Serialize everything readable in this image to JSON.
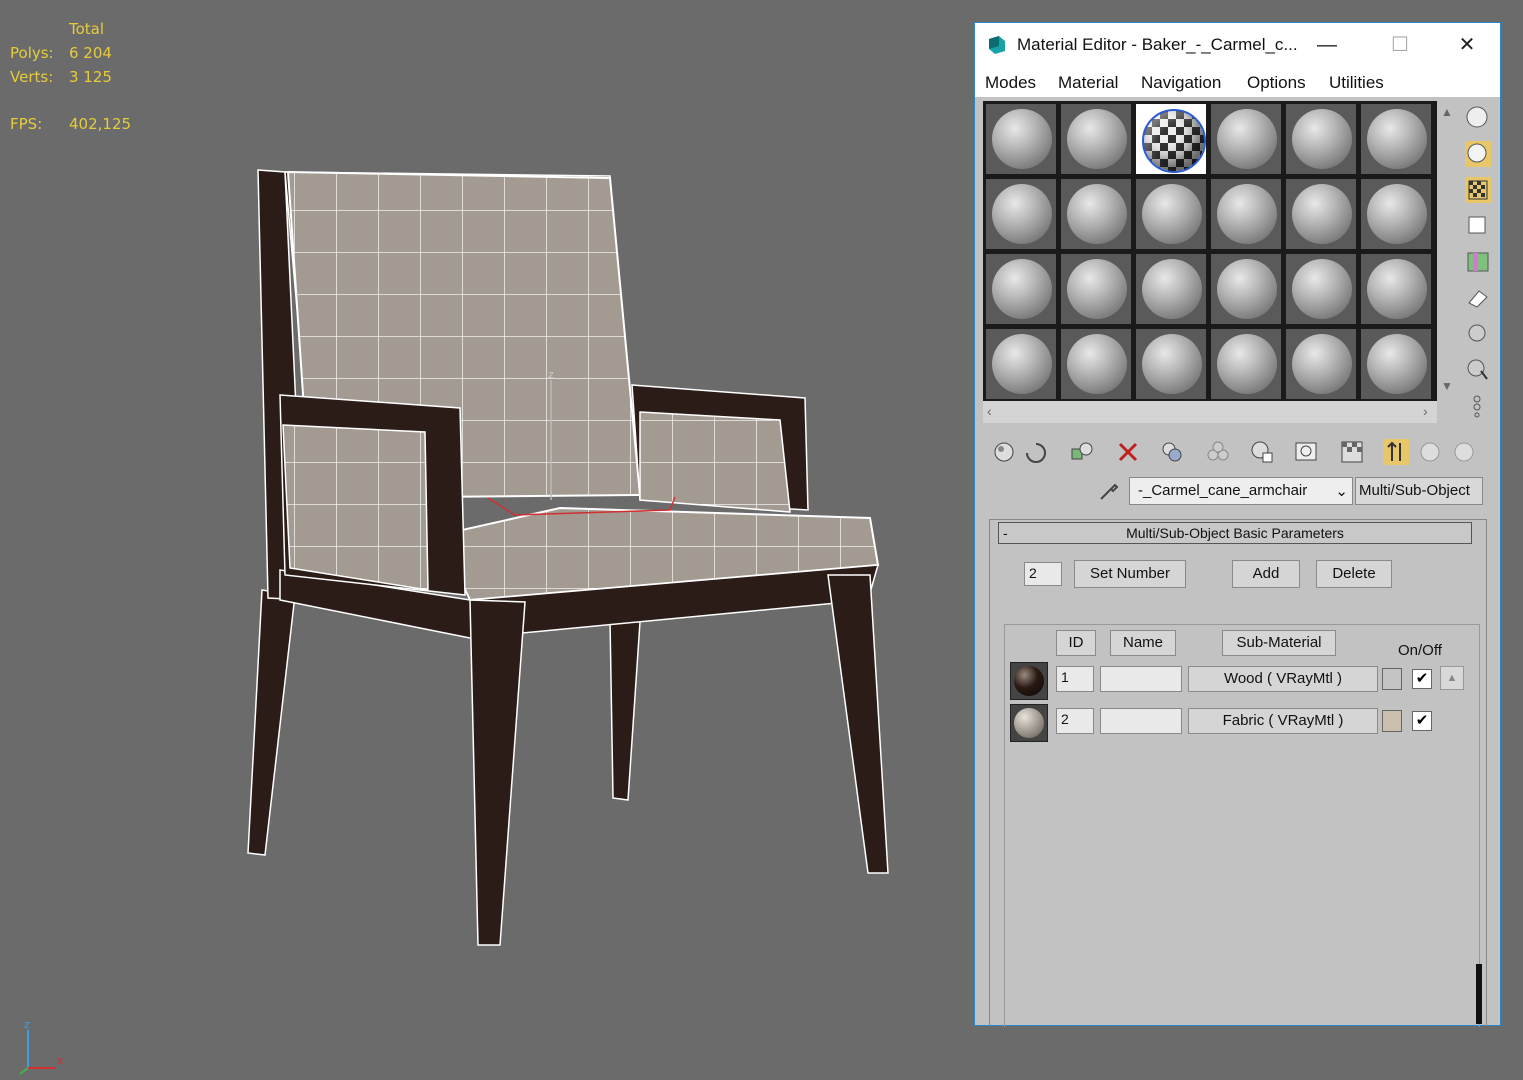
{
  "viewport": {
    "stats": {
      "total_label": "Total",
      "polys_label": "Polys:",
      "polys_value": "6 204",
      "verts_label": "Verts:",
      "verts_value": "3 125",
      "fps_label": "FPS:",
      "fps_value": "402,125"
    },
    "pivot_label": "z",
    "axis": {
      "x": "x",
      "z": "z"
    }
  },
  "material_editor": {
    "title": "Material Editor - Baker_-_Carmel_c...",
    "window_buttons": {
      "minimize": "—",
      "maximize": "☐",
      "close": "✕"
    },
    "menu": [
      "Modes",
      "Material",
      "Navigation",
      "Options",
      "Utilities"
    ],
    "slot_grid": {
      "rows": 4,
      "cols": 6,
      "active_slot": 2
    },
    "material_name": "-_Carmel_cane_armchair",
    "material_type": "Multi/Sub-Object",
    "rollout_title": "Multi/Sub-Object Basic Parameters",
    "rollout_toggle": "-",
    "set_number_value": "2",
    "buttons": {
      "set_number": "Set Number",
      "add": "Add",
      "delete": "Delete"
    },
    "columns": {
      "id": "ID",
      "name": "Name",
      "sub_material": "Sub-Material",
      "on_off": "On/Off"
    },
    "rows": [
      {
        "id": "1",
        "name": "",
        "sub_material": "Wood  ( VRayMtl )",
        "color": "#c4c4c4",
        "checked": "✔"
      },
      {
        "id": "2",
        "name": "",
        "sub_material": "Fabric  ( VRayMtl )",
        "color": "#cbbfae",
        "checked": "✔"
      }
    ],
    "colors": {
      "border": "#2a86c8",
      "panel": "#c2c2c2",
      "stats": "#e6cc3a"
    }
  }
}
